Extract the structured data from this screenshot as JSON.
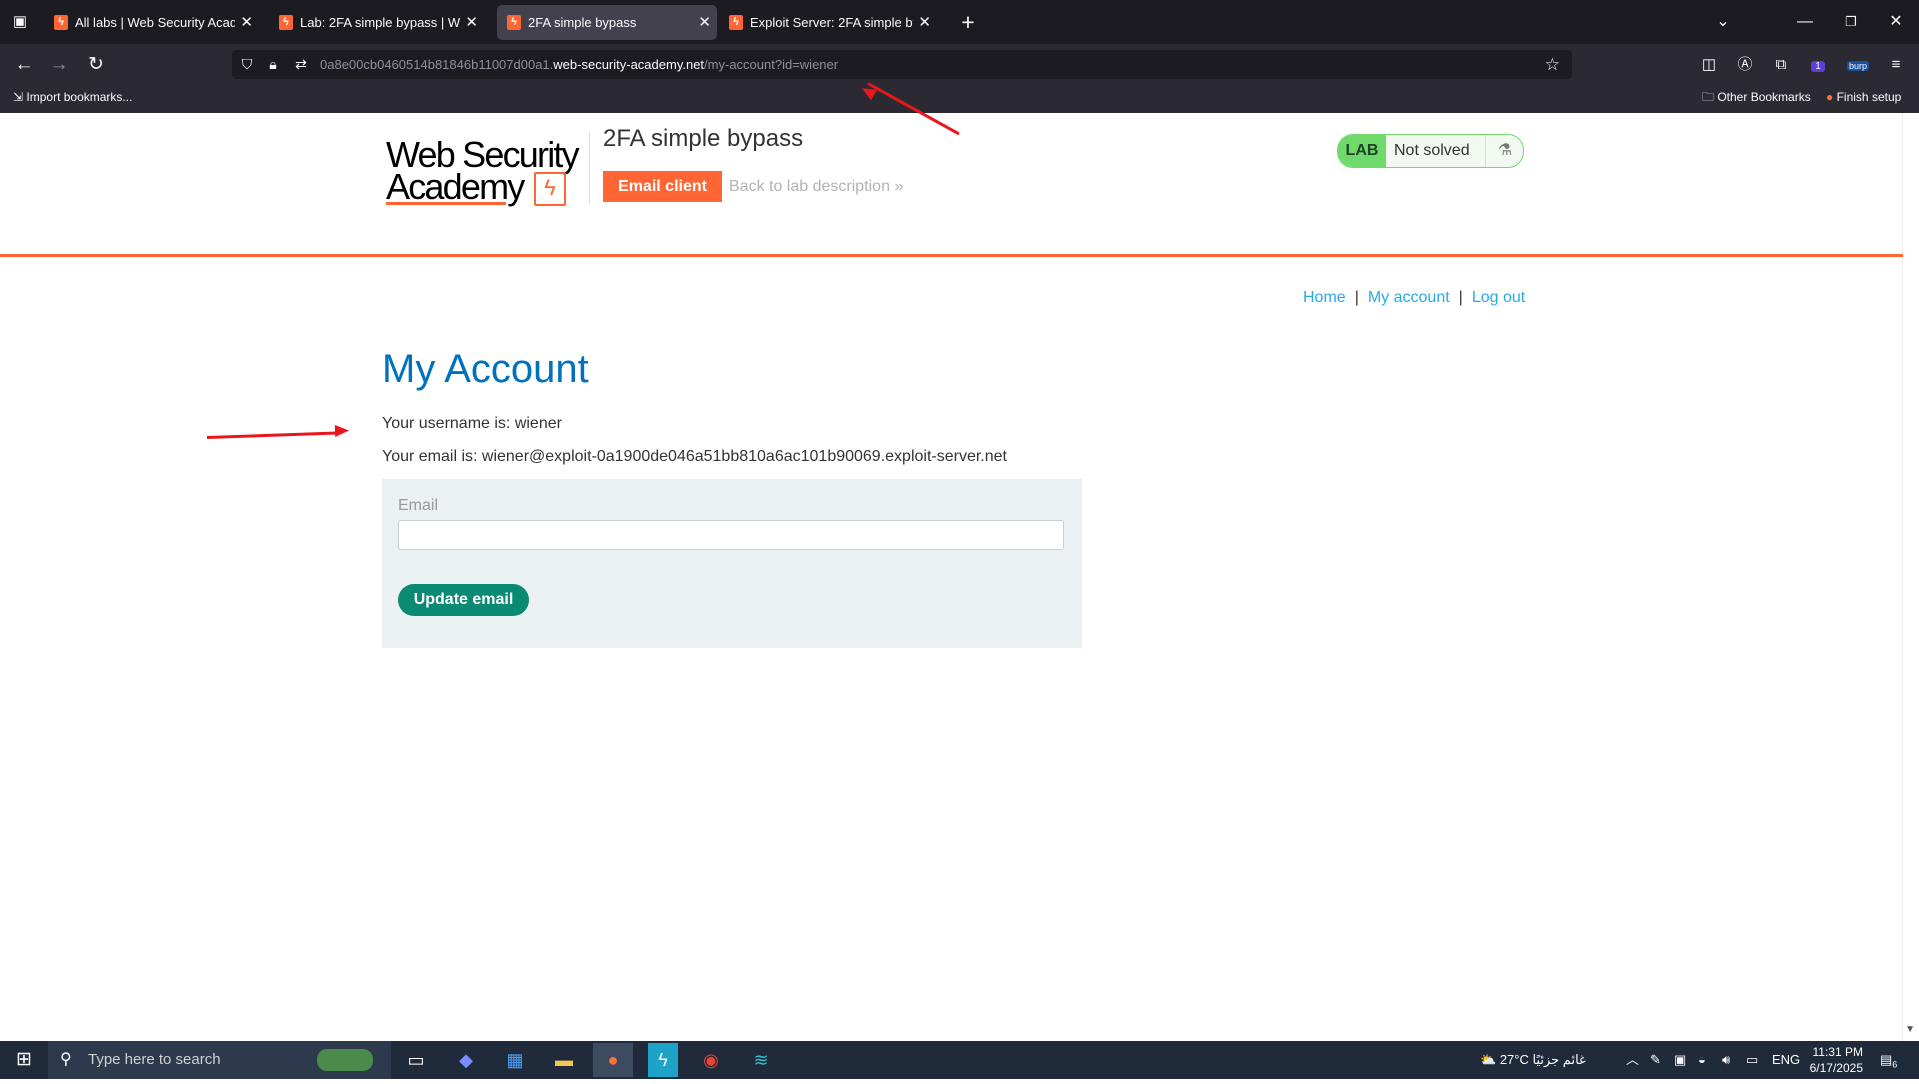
{
  "browser": {
    "tabs": [
      {
        "title": "All labs | Web Security Academy",
        "active": false
      },
      {
        "title": "Lab: 2FA simple bypass | Web Se",
        "active": false
      },
      {
        "title": "2FA simple bypass",
        "active": true
      },
      {
        "title": "Exploit Server: 2FA simple bypa",
        "active": false
      }
    ],
    "url": {
      "prefix": "0a8e00cb0460514b81846b11007d00a1.",
      "domain": "web-security-academy.net",
      "path": "/my-account?id=wiener"
    },
    "bookmarks": {
      "import": "Import bookmarks...",
      "other": "Other Bookmarks",
      "finish": "Finish setup"
    },
    "extension_badge": "1",
    "burp_label": "burp"
  },
  "header": {
    "logo_line1": "Web Security",
    "logo_line2": "Academy",
    "lab_title": "2FA simple bypass",
    "email_client": "Email client",
    "back_link": "Back to lab description",
    "status_lab": "LAB",
    "status_text": "Not solved",
    "accent_color": "#ff6633"
  },
  "nav": {
    "home": "Home",
    "my_account": "My account",
    "log_out": "Log out"
  },
  "account": {
    "heading": "My Account",
    "username_line": "Your username is: wiener",
    "email_line": "Your email is: wiener@exploit-0a1900de046a51bb810a6ac101b90069.exploit-server.net",
    "email_label": "Email",
    "email_value": "",
    "update_button": "Update email"
  },
  "taskbar": {
    "search_placeholder": "Type here to search",
    "weather": "27°C",
    "weather_desc": "غائم جزئيًا",
    "language": "ENG",
    "time": "11:31 PM",
    "date": "6/17/2025",
    "notifications": "6"
  }
}
